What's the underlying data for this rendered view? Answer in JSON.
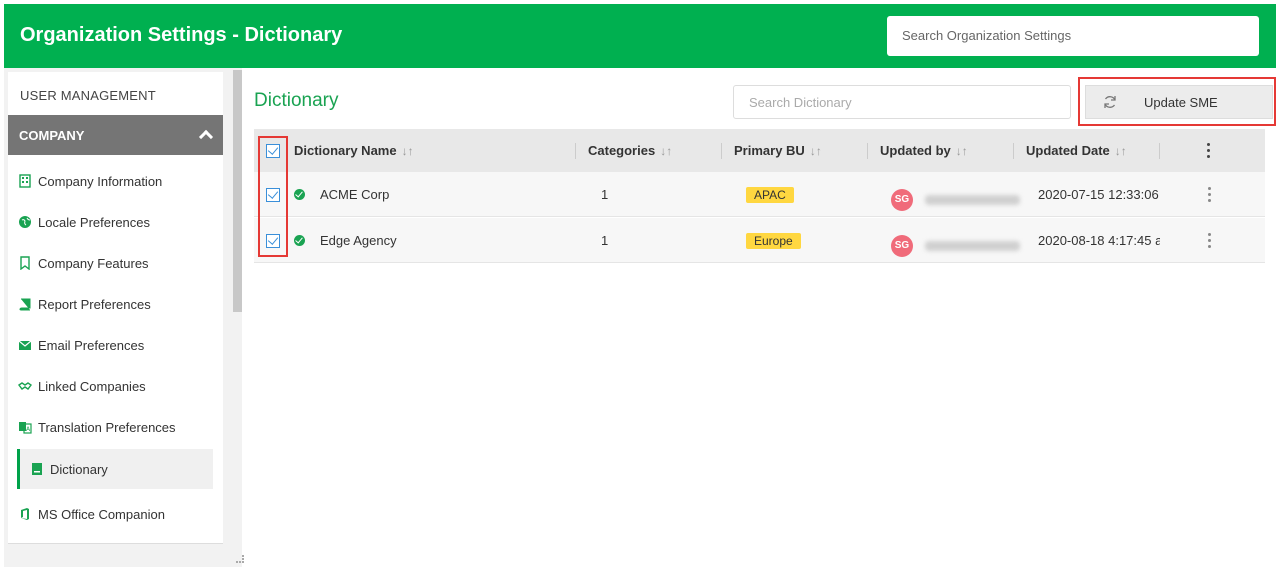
{
  "header": {
    "title": "Organization Settings - Dictionary",
    "search_placeholder": "Search Organization Settings"
  },
  "sidebar": {
    "section_user": "USER MANAGEMENT",
    "section_company": "COMPANY",
    "items": [
      {
        "label": "Company Information",
        "icon": "building-icon"
      },
      {
        "label": "Locale Preferences",
        "icon": "globe-icon"
      },
      {
        "label": "Company Features",
        "icon": "bookmark-icon"
      },
      {
        "label": "Report Preferences",
        "icon": "book-icon"
      },
      {
        "label": "Email Preferences",
        "icon": "envelope-icon"
      },
      {
        "label": "Linked Companies",
        "icon": "handshake-icon"
      },
      {
        "label": "Translation Preferences",
        "icon": "translate-icon"
      },
      {
        "label": "Dictionary",
        "icon": "dictionary-icon",
        "active": true
      },
      {
        "label": "MS Office Companion",
        "icon": "office-icon"
      }
    ]
  },
  "main": {
    "title": "Dictionary",
    "search_placeholder": "Search Dictionary",
    "update_button": "Update SME",
    "columns": [
      "Dictionary Name",
      "Categories",
      "Primary BU",
      "Updated by",
      "Updated Date"
    ],
    "sort_glyph": "↓↑",
    "rows": [
      {
        "name": "ACME Corp",
        "categories": "1",
        "bu": "APAC",
        "user_initials": "SG",
        "date": "2020-07-15 12:33:06"
      },
      {
        "name": "Edge Agency",
        "categories": "1",
        "bu": "Europe",
        "user_initials": "SG",
        "date": "2020-08-18 4:17:45 a"
      }
    ]
  },
  "colors": {
    "brand": "#00b050",
    "accent_text": "#1aa352",
    "badge": "#ffd740",
    "avatar": "#f06b7a",
    "highlight": "#e53935"
  }
}
